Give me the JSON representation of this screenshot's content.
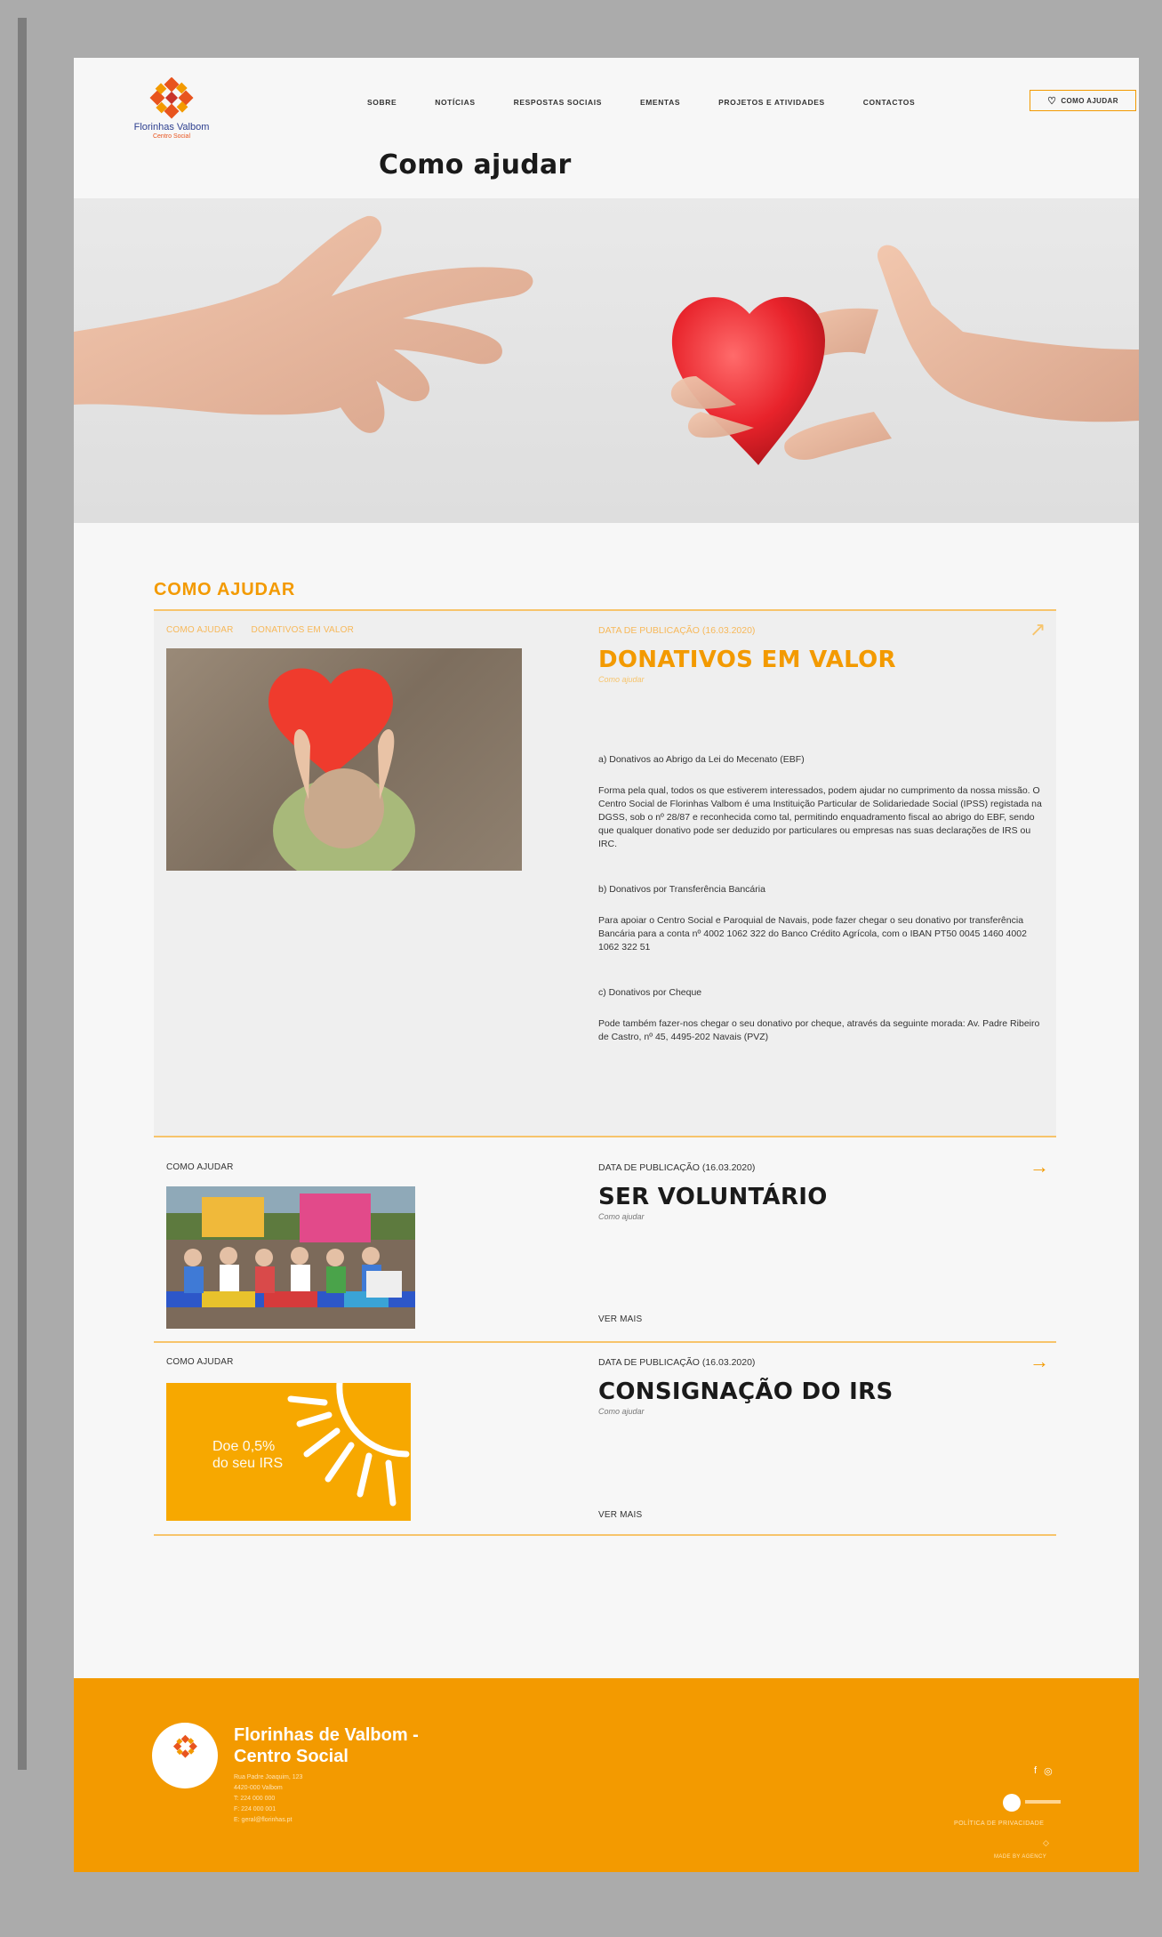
{
  "header": {
    "logo_name": "Florinhas Valbom",
    "logo_sub": "Centro Social",
    "nav": [
      "SOBRE",
      "NOTÍCIAS",
      "RESPOSTAS SOCIAIS",
      "EMENTAS",
      "PROJETOS E ATIVIDADES",
      "CONTACTOS"
    ],
    "help_button": "COMO AJUDAR",
    "page_title": "Como ajudar"
  },
  "section": {
    "title": "COMO AJUDAR"
  },
  "featured": {
    "categories": [
      "COMO AJUDAR",
      "DONATIVOS EM VALOR"
    ],
    "date": "DATA DE PUBLICAÇÃO (16.03.2020)",
    "title": "DONATIVOS EM VALOR",
    "subtitle": "Como ajudar",
    "p1_title": "a) Donativos ao Abrigo da Lei do Mecenato (EBF)",
    "p1": "Forma pela qual, todos os que estiverem interessados, podem ajudar no cumprimento da nossa missão. O Centro Social de Florinhas Valbom é uma Instituição Particular de Solidariedade Social (IPSS) registada na DGSS, sob o nº 28/87 e reconhecida como tal, permitindo enquadramento fiscal ao abrigo do EBF, sendo que qualquer donativo pode ser deduzido por particulares ou empresas nas suas declarações de IRS ou IRC.",
    "p2_title": "b) Donativos por Transferência Bancária",
    "p2": "Para apoiar o Centro Social e Paroquial de Navais, pode fazer chegar o seu donativo por transferência Bancária para a conta nº 4002 1062 322 do Banco Crédito Agrícola, com o IBAN PT50 0045 1460 4002 1062 322 51",
    "p3_title": "c) Donativos por Cheque",
    "p3": "Pode também fazer-nos chegar o seu donativo por cheque, através da seguinte morada: Av. Padre Ribeiro de Castro, nº 45, 4495-202 Navais (PVZ)"
  },
  "items": [
    {
      "category": "COMO AJUDAR",
      "date": "DATA DE PUBLICAÇÃO (16.03.2020)",
      "title": "SER VOLUNTÁRIO",
      "subtitle": "Como ajudar",
      "more": "VER MAIS"
    },
    {
      "category": "COMO AJUDAR",
      "date": "DATA DE PUBLICAÇÃO (16.03.2020)",
      "title": "CONSIGNAÇÃO DO IRS",
      "subtitle": "Como ajudar",
      "more": "VER MAIS",
      "image_text_1": "Doe 0,5%",
      "image_text_2": "do seu IRS"
    }
  ],
  "footer": {
    "name_line1": "Florinhas de Valbom -",
    "name_line2": "Centro Social",
    "address": [
      "Rua Padre Joaquim, 123",
      "4420-000 Valbom",
      "T: 224 000 000",
      "F: 224 000 001",
      "E: geral@florinhas.pt"
    ],
    "privacy": "POLÍTICA DE PRIVACIDADE",
    "credit": "MADE BY AGENCY"
  },
  "colors": {
    "accent": "#f39a00",
    "accent_light": "#f7c46b",
    "navy": "#2d3f8f",
    "red": "#e8541e"
  }
}
